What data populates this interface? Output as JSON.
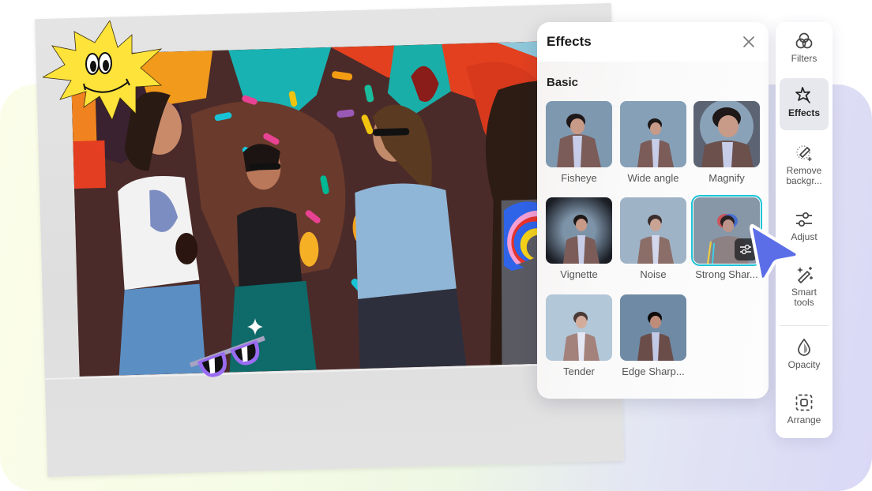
{
  "colors": {
    "accent_selected": "#19c3d6",
    "cursor": "#5b6ee8",
    "active_tool_bg": "#e6e8ee",
    "sunglasses": "#9a6cf2",
    "sun_sticker": "#fde33a"
  },
  "stickers": [
    {
      "name": "smiling-sun-sticker"
    },
    {
      "name": "rainbow-sticker"
    },
    {
      "name": "sunglasses-sticker"
    },
    {
      "name": "sparkle-sticker"
    }
  ],
  "effects_panel": {
    "title": "Effects",
    "close_icon": "close-icon",
    "section_title": "Basic",
    "effects": [
      {
        "label": "Fisheye",
        "selected": false
      },
      {
        "label": "Wide angle",
        "selected": false
      },
      {
        "label": "Magnify",
        "selected": false
      },
      {
        "label": "Vignette",
        "selected": false
      },
      {
        "label": "Noise",
        "selected": false
      },
      {
        "label": "Strong Shar...",
        "selected": true,
        "settings_icon": "sliders-icon"
      },
      {
        "label": "Tender",
        "selected": false
      },
      {
        "label": "Edge Sharp...",
        "selected": false
      }
    ]
  },
  "toolbar": {
    "items": [
      {
        "label": "Filters",
        "icon": "three-circles-icon",
        "active": false
      },
      {
        "label": "Effects",
        "icon": "star-wand-icon",
        "active": true
      },
      {
        "label": "Remove backgr...",
        "icon": "magic-eraser-icon",
        "active": false
      },
      {
        "label": "Adjust",
        "icon": "sliders-icon",
        "active": false
      },
      {
        "label": "Smart tools",
        "icon": "magic-wand-icon",
        "active": false
      },
      {
        "label": "Opacity",
        "icon": "droplet-icon",
        "active": false
      },
      {
        "label": "Arrange",
        "icon": "arrange-icon",
        "active": false
      }
    ]
  }
}
